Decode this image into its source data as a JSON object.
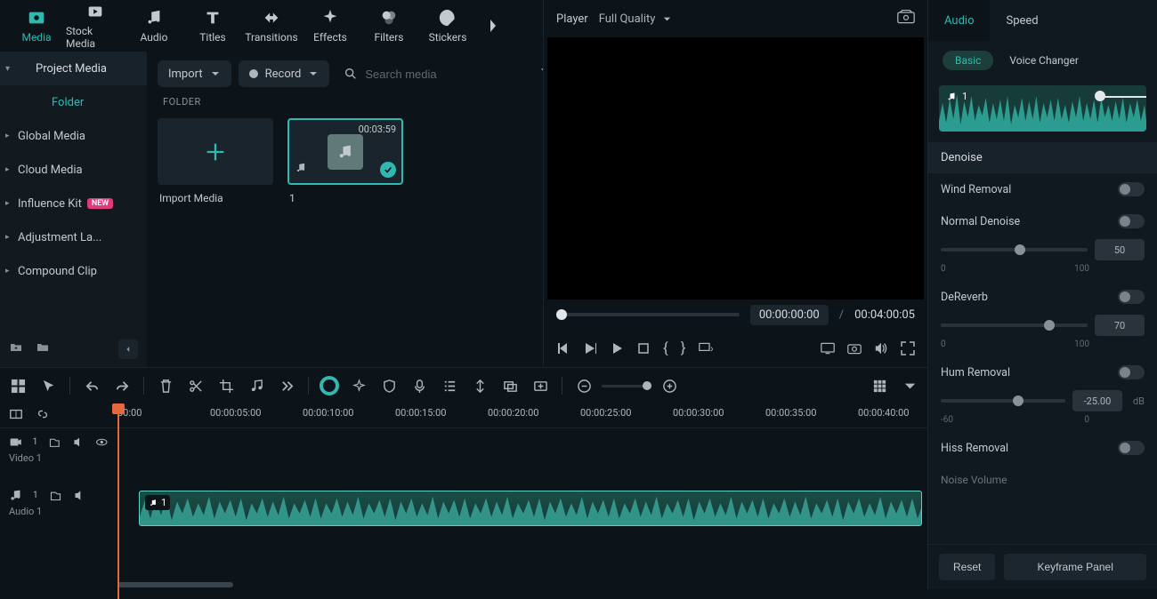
{
  "top_tabs": [
    {
      "id": "media",
      "label": "Media",
      "active": true
    },
    {
      "id": "stock",
      "label": "Stock Media"
    },
    {
      "id": "audio",
      "label": "Audio"
    },
    {
      "id": "titles",
      "label": "Titles"
    },
    {
      "id": "transitions",
      "label": "Transitions"
    },
    {
      "id": "effects",
      "label": "Effects"
    },
    {
      "id": "filters",
      "label": "Filters"
    },
    {
      "id": "stickers",
      "label": "Stickers"
    }
  ],
  "sidebar": {
    "project": "Project Media",
    "folder": "Folder",
    "items": [
      {
        "label": "Global Media"
      },
      {
        "label": "Cloud Media"
      },
      {
        "label": "Influence Kit",
        "badge": "NEW"
      },
      {
        "label": "Adjustment La..."
      },
      {
        "label": "Compound Clip"
      }
    ]
  },
  "media_toolbar": {
    "import": "Import",
    "record": "Record",
    "search_placeholder": "Search media",
    "folder_label": "FOLDER"
  },
  "thumbs": {
    "import_label": "Import Media",
    "clip": {
      "duration": "00:03:59",
      "name": "1"
    }
  },
  "player": {
    "label": "Player",
    "quality": "Full Quality",
    "current": "00:00:00:00",
    "sep": "/",
    "total": "00:04:00:05"
  },
  "ruler": [
    "00:00",
    "00:00:05:00",
    "00:00:10:00",
    "00:00:15:00",
    "00:00:20:00",
    "00:00:25:00",
    "00:00:30:00",
    "00:00:35:00",
    "00:00:40:00"
  ],
  "tracks": {
    "video": "Video 1",
    "audio": "Audio 1",
    "clip_name": "1"
  },
  "props": {
    "tabs": {
      "audio": "Audio",
      "speed": "Speed"
    },
    "sub": {
      "basic": "Basic",
      "vc": "Voice Changer"
    },
    "wave_name": "1",
    "section": "Denoise",
    "wind": "Wind Removal",
    "normal": "Normal Denoise",
    "normal_val": "50",
    "normal_min": "0",
    "normal_max": "100",
    "dereverb": "DeReverb",
    "dereverb_val": "70",
    "dereverb_min": "0",
    "dereverb_max": "100",
    "hum": "Hum Removal",
    "hum_val": "-25.00",
    "hum_unit": "dB",
    "hum_min": "-60",
    "hum_max": "0",
    "hiss": "Hiss Removal",
    "noise_vol": "Noise Volume",
    "reset": "Reset",
    "keyframe": "Keyframe Panel"
  }
}
